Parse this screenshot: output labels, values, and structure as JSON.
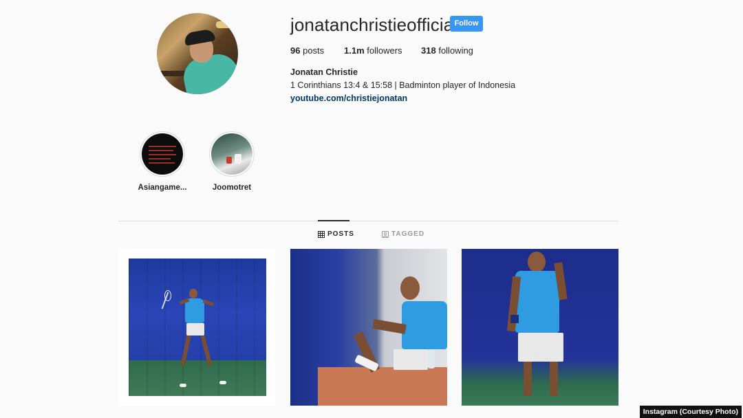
{
  "profile": {
    "username": "jonatanchristieofficial",
    "follow_label": "Follow",
    "posts_count": "96",
    "posts_label": "posts",
    "followers_count": "1.1m",
    "followers_label": "followers",
    "following_count": "318",
    "following_label": "following",
    "full_name": "Jonatan Christie",
    "bio": "1 Corinthians 13:4 & 15:58 | Badminton player of Indonesia",
    "link": "youtube.com/christiejonatan"
  },
  "highlights": [
    {
      "label": "Asiangame..."
    },
    {
      "label": "Joomotret"
    }
  ],
  "tabs": {
    "posts": "POSTS",
    "tagged": "TAGGED",
    "active": "posts"
  },
  "caption": "Instagram (Courtesy Photo)",
  "colors": {
    "follow_button": "#3897f0",
    "link": "#003569",
    "background": "#fafafa"
  },
  "icons": {
    "posts_tab": "grid-icon",
    "tagged_tab": "tag-person-icon"
  }
}
